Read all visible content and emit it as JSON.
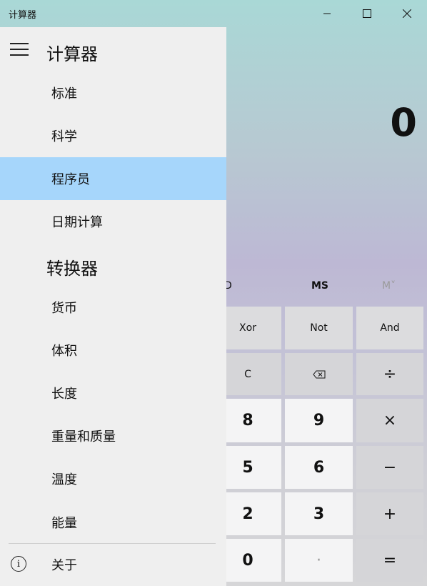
{
  "window": {
    "title": "计算器"
  },
  "display": {
    "value": "0"
  },
  "memory": {
    "md_partial": "D",
    "ms": "MS",
    "mv": "M˅"
  },
  "keys": {
    "xor": "Xor",
    "not": "Not",
    "and": "And",
    "clear": "C",
    "backspace_icon": "backspace-icon",
    "divide": "÷",
    "eight": "8",
    "nine": "9",
    "multiply": "×",
    "five": "5",
    "six": "6",
    "minus": "−",
    "two": "2",
    "three": "3",
    "plus": "+",
    "zero": "0",
    "decimal": "·",
    "equals": "="
  },
  "nav": {
    "header_calculator": "计算器",
    "items_calc": [
      "标准",
      "科学",
      "程序员",
      "日期计算"
    ],
    "selected": "程序员",
    "header_converter": "转换器",
    "items_conv": [
      "货币",
      "体积",
      "长度",
      "重量和质量",
      "温度",
      "能量"
    ],
    "about": "关于"
  }
}
